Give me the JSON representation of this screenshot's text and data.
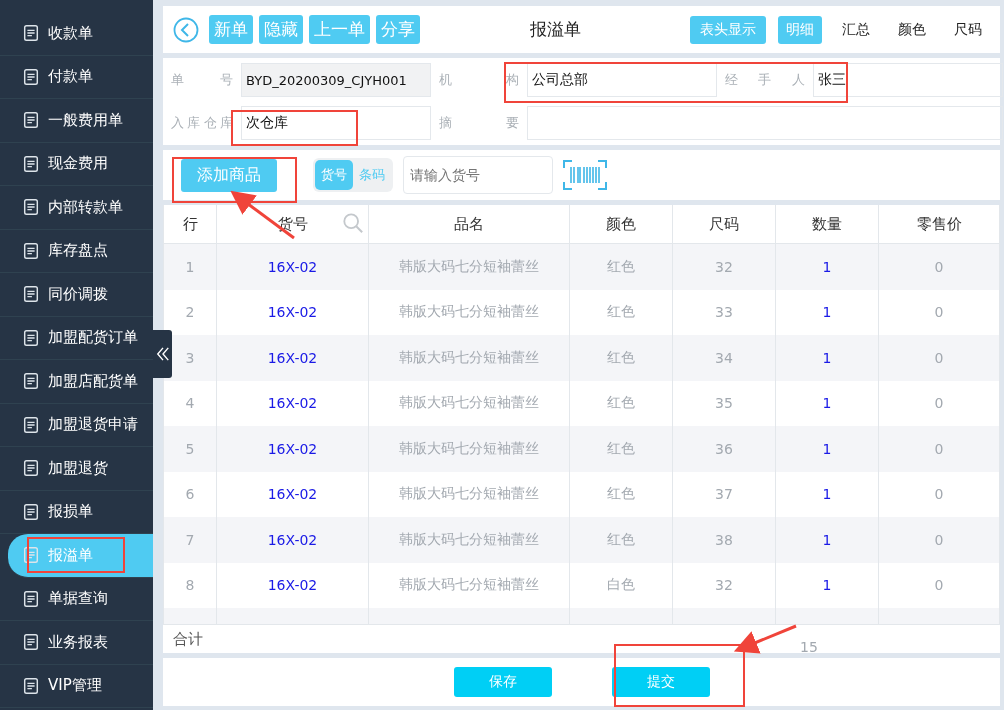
{
  "sidebar": {
    "items": [
      {
        "label": "收款单",
        "selected": false
      },
      {
        "label": "付款单",
        "selected": false
      },
      {
        "label": "一般费用单",
        "selected": false
      },
      {
        "label": "现金费用",
        "selected": false
      },
      {
        "label": "内部转款单",
        "selected": false
      },
      {
        "label": "库存盘点",
        "selected": false
      },
      {
        "label": "同价调拨",
        "selected": false
      },
      {
        "label": "加盟配货订单",
        "selected": false
      },
      {
        "label": "加盟店配货单",
        "selected": false
      },
      {
        "label": "加盟退货申请",
        "selected": false
      },
      {
        "label": "加盟退货",
        "selected": false
      },
      {
        "label": "报损单",
        "selected": false
      },
      {
        "label": "报溢单",
        "selected": true
      },
      {
        "label": "单据查询",
        "selected": false
      },
      {
        "label": "业务报表",
        "selected": false
      },
      {
        "label": "VIP管理",
        "selected": false
      }
    ]
  },
  "toolbar": {
    "buttons": [
      "新单",
      "隐藏",
      "上一单",
      "分享"
    ],
    "title": "报溢单",
    "header_button": "表头显示",
    "view_tabs": [
      {
        "label": "明细",
        "selected": true
      },
      {
        "label": "汇总",
        "selected": false
      },
      {
        "label": "颜色",
        "selected": false
      },
      {
        "label": "尺码",
        "selected": false
      }
    ]
  },
  "form": {
    "fields": [
      {
        "label": "单 号",
        "value": "BYD_20200309_CJYH001",
        "readonly": true
      },
      {
        "label": "机 构",
        "value": "公司总部",
        "readonly": false
      },
      {
        "label": "经 手 人",
        "value": "张三",
        "readonly": false
      },
      {
        "label": "入库仓库",
        "value": "次仓库",
        "readonly": false
      },
      {
        "label": "摘 要",
        "readonly": false,
        "wide": true
      }
    ]
  },
  "add_bar": {
    "add_button": "添加商品",
    "mode_toggle": [
      {
        "label": "货号",
        "selected": true
      },
      {
        "label": "条码",
        "selected": false
      }
    ],
    "search": {
      "placeholder": "请输入货号"
    }
  },
  "table": {
    "columns": [
      "行",
      "货号",
      "品名",
      "颜色",
      "尺码",
      "数量",
      "零售价"
    ],
    "rows": [
      [
        "1",
        "16X-02",
        "韩版大码七分短袖蕾丝",
        "红色",
        "32",
        "1",
        "0"
      ],
      [
        "2",
        "16X-02",
        "韩版大码七分短袖蕾丝",
        "红色",
        "33",
        "1",
        "0"
      ],
      [
        "3",
        "16X-02",
        "韩版大码七分短袖蕾丝",
        "红色",
        "34",
        "1",
        "0"
      ],
      [
        "4",
        "16X-02",
        "韩版大码七分短袖蕾丝",
        "红色",
        "35",
        "1",
        "0"
      ],
      [
        "5",
        "16X-02",
        "韩版大码七分短袖蕾丝",
        "红色",
        "36",
        "1",
        "0"
      ],
      [
        "6",
        "16X-02",
        "韩版大码七分短袖蕾丝",
        "红色",
        "37",
        "1",
        "0"
      ],
      [
        "7",
        "16X-02",
        "韩版大码七分短袖蕾丝",
        "红色",
        "38",
        "1",
        "0"
      ],
      [
        "8",
        "16X-02",
        "韩版大码七分短袖蕾丝",
        "白色",
        "32",
        "1",
        "0"
      ]
    ],
    "total_label": "合计",
    "total_quantity": "15"
  },
  "footer_buttons": [
    "保存",
    "提交"
  ]
}
